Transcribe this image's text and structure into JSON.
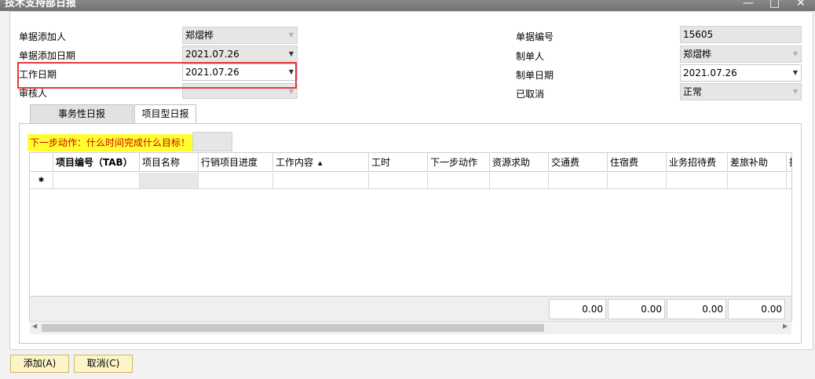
{
  "window": {
    "title": "技术支持部日报",
    "minimize": "—",
    "maximize": "□",
    "close": "✕"
  },
  "fields": {
    "adder_label": "单据添加人",
    "adder_value": "郑熠桦",
    "add_date_label": "单据添加日期",
    "add_date_value": "2021.07.26",
    "work_date_label": "工作日期",
    "work_date_value": "2021.07.26",
    "reviewer_label": "审核人",
    "reviewer_value": "",
    "doc_no_label": "单据编号",
    "doc_no_value": "15605",
    "creator_label": "制单人",
    "creator_value": "郑熠桦",
    "create_date_label": "制单日期",
    "create_date_value": "2021.07.26",
    "cancelled_label": "已取消",
    "cancelled_value": "正常"
  },
  "tabs": [
    {
      "label": "事务性日报",
      "active": true
    },
    {
      "label": "项目型日报",
      "active": false
    }
  ],
  "hint": "下一步动作：什么时间完成什么目标！",
  "grid": {
    "columns": [
      "项目编号（TAB）",
      "项目名称",
      "行销项目进度",
      "工作内容",
      "工时",
      "下一步动作",
      "资源求助",
      "交通费",
      "住宿费",
      "业务招待费",
      "差旅补助",
      "挂"
    ],
    "new_row_marker": "✱",
    "totals": [
      "0.00",
      "0.00",
      "0.00",
      "0.00"
    ]
  },
  "buttons": {
    "add": "添加(A)",
    "cancel": "取消(C)"
  },
  "colors": {
    "highlight": "#e23b3b",
    "hint_bg": "#ffff30",
    "hint_text": "#d40000",
    "button_bg": "#fdf5c8"
  }
}
